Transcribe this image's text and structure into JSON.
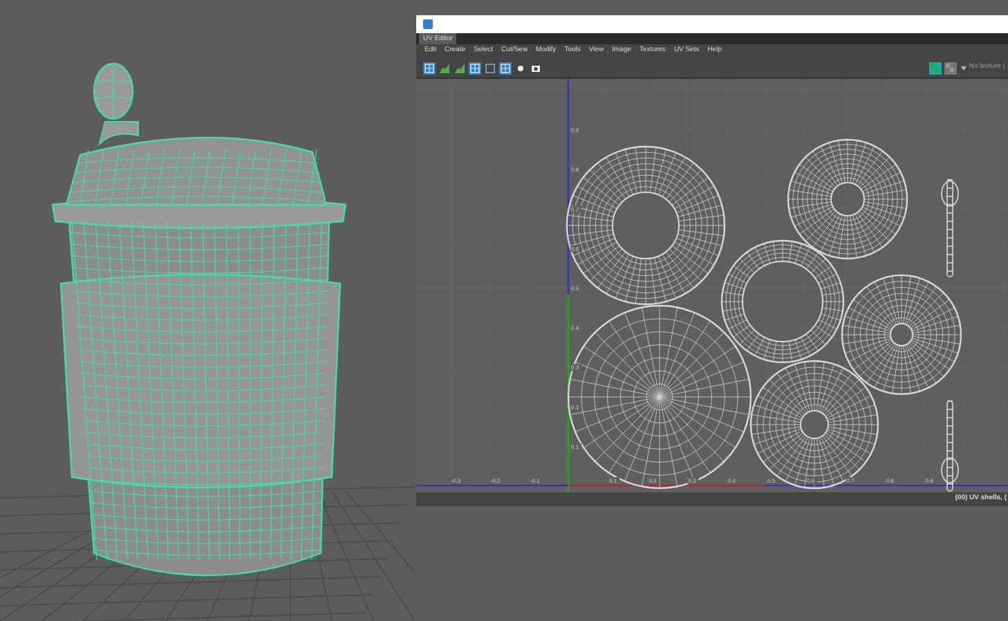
{
  "uv_editor": {
    "tab": {
      "label": "UV Editor",
      "selected": true
    },
    "menu": [
      "Edit",
      "Create",
      "Select",
      "Cut/Sew",
      "Modify",
      "Tools",
      "View",
      "Image",
      "Textures",
      "UV Sets",
      "Help"
    ],
    "toolbar": [
      {
        "kind": "grid",
        "selected": true
      },
      {
        "kind": "shade",
        "selected": false
      },
      {
        "kind": "shade",
        "selected": false
      },
      {
        "kind": "grid",
        "selected": true
      },
      {
        "kind": "frame",
        "selected": false
      },
      {
        "kind": "grid",
        "selected": true
      },
      {
        "kind": "dot",
        "selected": false
      },
      {
        "kind": "camera",
        "selected": false
      }
    ],
    "texture_toggles": [
      {
        "selected": true
      },
      {
        "selected": false
      }
    ],
    "texture_dropdown": {
      "value": "No texture ("
    },
    "u_labels": [
      "-0.3",
      "-0.2",
      "-0.1",
      "0.1",
      "0.2",
      "0.3",
      "0.4",
      "0.5",
      "0.6",
      "0.7",
      "0.8",
      "0.9"
    ],
    "v_labels": [
      "0.9",
      "0.8",
      "0.7",
      "0.6",
      "0.5",
      "0.4",
      "0.3",
      "0.2",
      "0.1"
    ],
    "status": "(00) UV shells, ("
  }
}
